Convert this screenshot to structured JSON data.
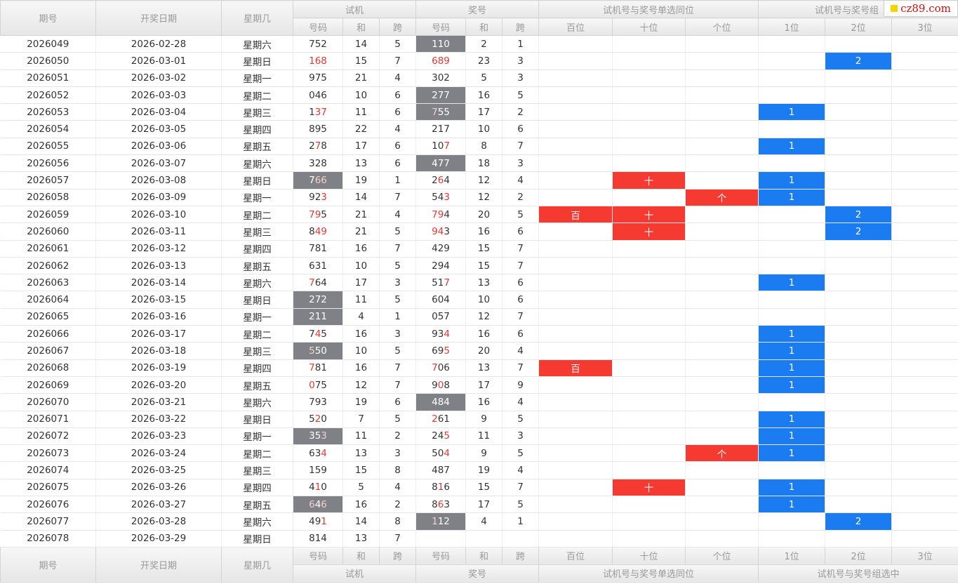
{
  "logo_text": "cz89.com",
  "headers": {
    "period": "期号",
    "date": "开奖日期",
    "weekday": "星期几",
    "trial": "试机",
    "prize": "奖号",
    "single": "试机号与奖号单选同位",
    "group_top": "试机号与奖号组",
    "group_full": "试机号与奖号组选中",
    "sub": {
      "code": "号码",
      "sum": "和",
      "span": "跨",
      "hundreds": "百位",
      "tens": "十位",
      "ones": "个位",
      "pos1": "1位",
      "pos2": "2位",
      "pos3": "3位"
    }
  },
  "rows": [
    {
      "period": "2026049",
      "date": "2026-02-28",
      "weekday": "星期六",
      "trial": [
        [
          "752",
          ""
        ]
      ],
      "trial_sum": "14",
      "trial_span": "5",
      "prize": [
        [
          "110",
          ""
        ]
      ],
      "prize_gray": true,
      "prize_sum": "2",
      "prize_span": "1",
      "single": [
        "",
        "",
        ""
      ],
      "group": [
        "",
        "",
        ""
      ]
    },
    {
      "period": "2026050",
      "date": "2026-03-01",
      "weekday": "星期日",
      "trial": [
        [
          "",
          "168"
        ]
      ],
      "trial_sum": "15",
      "trial_span": "7",
      "prize": [
        [
          "",
          "689"
        ]
      ],
      "prize_sum": "23",
      "prize_span": "3",
      "single": [
        "",
        "",
        ""
      ],
      "group": [
        "",
        "2",
        ""
      ]
    },
    {
      "period": "2026051",
      "date": "2026-03-02",
      "weekday": "星期一",
      "trial": [
        [
          "975",
          ""
        ]
      ],
      "trial_sum": "21",
      "trial_span": "4",
      "prize": [
        [
          "302",
          ""
        ]
      ],
      "prize_sum": "5",
      "prize_span": "3",
      "single": [
        "",
        "",
        ""
      ],
      "group": [
        "",
        "",
        ""
      ]
    },
    {
      "period": "2026052",
      "date": "2026-03-03",
      "weekday": "星期二",
      "trial": [
        [
          "046",
          ""
        ]
      ],
      "trial_sum": "10",
      "trial_span": "6",
      "prize": [
        [
          "277",
          ""
        ]
      ],
      "prize_gray": true,
      "prize_sum": "16",
      "prize_span": "5",
      "single": [
        "",
        "",
        ""
      ],
      "group": [
        "",
        "",
        ""
      ]
    },
    {
      "period": "2026053",
      "date": "2026-03-04",
      "weekday": "星期三",
      "trial": [
        [
          "1",
          ""
        ],
        [
          "",
          "37"
        ]
      ],
      "trial_sum": "11",
      "trial_span": "6",
      "prize": [
        [
          "",
          "7"
        ],
        [
          "55",
          ""
        ]
      ],
      "prize_gray": true,
      "prize_sum": "17",
      "prize_span": "2",
      "single": [
        "",
        "",
        ""
      ],
      "group": [
        "1",
        "",
        ""
      ]
    },
    {
      "period": "2026054",
      "date": "2026-03-05",
      "weekday": "星期四",
      "trial": [
        [
          "895",
          ""
        ]
      ],
      "trial_sum": "22",
      "trial_span": "4",
      "prize": [
        [
          "217",
          ""
        ]
      ],
      "prize_sum": "10",
      "prize_span": "6",
      "single": [
        "",
        "",
        ""
      ],
      "group": [
        "",
        "",
        ""
      ]
    },
    {
      "period": "2026055",
      "date": "2026-03-06",
      "weekday": "星期五",
      "trial": [
        [
          "2",
          ""
        ],
        [
          "",
          "7"
        ],
        [
          "8",
          ""
        ]
      ],
      "trial_sum": "17",
      "trial_span": "6",
      "prize": [
        [
          "10",
          ""
        ],
        [
          "",
          "7"
        ]
      ],
      "prize_sum": "8",
      "prize_span": "7",
      "single": [
        "",
        "",
        ""
      ],
      "group": [
        "1",
        "",
        ""
      ]
    },
    {
      "period": "2026056",
      "date": "2026-03-07",
      "weekday": "星期六",
      "trial": [
        [
          "328",
          ""
        ]
      ],
      "trial_sum": "13",
      "trial_span": "6",
      "prize": [
        [
          "477",
          ""
        ]
      ],
      "prize_gray": true,
      "prize_sum": "18",
      "prize_span": "3",
      "single": [
        "",
        "",
        ""
      ],
      "group": [
        "",
        "",
        ""
      ]
    },
    {
      "period": "2026057",
      "date": "2026-03-08",
      "weekday": "星期日",
      "trial": [
        [
          "7",
          ""
        ],
        [
          "",
          "66"
        ]
      ],
      "trial_gray": true,
      "trial_sum": "19",
      "trial_span": "1",
      "prize": [
        [
          "2",
          ""
        ],
        [
          "",
          "6"
        ],
        [
          "4",
          ""
        ]
      ],
      "prize_sum": "12",
      "prize_span": "4",
      "single": [
        "",
        "十",
        ""
      ],
      "group": [
        "1",
        "",
        ""
      ]
    },
    {
      "period": "2026058",
      "date": "2026-03-09",
      "weekday": "星期一",
      "trial": [
        [
          "92",
          ""
        ],
        [
          "",
          "3"
        ]
      ],
      "trial_sum": "14",
      "trial_span": "7",
      "prize": [
        [
          "54",
          ""
        ],
        [
          "",
          "3"
        ]
      ],
      "prize_sum": "12",
      "prize_span": "2",
      "single": [
        "",
        "",
        "个"
      ],
      "group": [
        "1",
        "",
        ""
      ]
    },
    {
      "period": "2026059",
      "date": "2026-03-10",
      "weekday": "星期二",
      "trial": [
        [
          "",
          "79"
        ],
        [
          "5",
          ""
        ]
      ],
      "trial_sum": "21",
      "trial_span": "4",
      "prize": [
        [
          "",
          "79"
        ],
        [
          "4",
          ""
        ]
      ],
      "prize_sum": "20",
      "prize_span": "5",
      "single": [
        "百",
        "十",
        ""
      ],
      "group": [
        "",
        "2",
        ""
      ]
    },
    {
      "period": "2026060",
      "date": "2026-03-11",
      "weekday": "星期三",
      "trial": [
        [
          "8",
          ""
        ],
        [
          "",
          "49"
        ]
      ],
      "trial_sum": "21",
      "trial_span": "5",
      "prize": [
        [
          "",
          "94"
        ],
        [
          "3",
          ""
        ]
      ],
      "prize_sum": "16",
      "prize_span": "6",
      "single": [
        "",
        "十",
        ""
      ],
      "group": [
        "",
        "2",
        ""
      ]
    },
    {
      "period": "2026061",
      "date": "2026-03-12",
      "weekday": "星期四",
      "trial": [
        [
          "781",
          ""
        ]
      ],
      "trial_sum": "16",
      "trial_span": "7",
      "prize": [
        [
          "429",
          ""
        ]
      ],
      "prize_sum": "15",
      "prize_span": "7",
      "single": [
        "",
        "",
        ""
      ],
      "group": [
        "",
        "",
        ""
      ]
    },
    {
      "period": "2026062",
      "date": "2026-03-13",
      "weekday": "星期五",
      "trial": [
        [
          "631",
          ""
        ]
      ],
      "trial_sum": "10",
      "trial_span": "5",
      "prize": [
        [
          "294",
          ""
        ]
      ],
      "prize_sum": "15",
      "prize_span": "7",
      "single": [
        "",
        "",
        ""
      ],
      "group": [
        "",
        "",
        ""
      ]
    },
    {
      "period": "2026063",
      "date": "2026-03-14",
      "weekday": "星期六",
      "trial": [
        [
          "",
          "7"
        ],
        [
          "64",
          ""
        ]
      ],
      "trial_sum": "17",
      "trial_span": "3",
      "prize": [
        [
          "51",
          ""
        ],
        [
          "",
          "7"
        ]
      ],
      "prize_sum": "13",
      "prize_span": "6",
      "single": [
        "",
        "",
        ""
      ],
      "group": [
        "1",
        "",
        ""
      ]
    },
    {
      "period": "2026064",
      "date": "2026-03-15",
      "weekday": "星期日",
      "trial": [
        [
          "272",
          ""
        ]
      ],
      "trial_gray": true,
      "trial_sum": "11",
      "trial_span": "5",
      "prize": [
        [
          "604",
          ""
        ]
      ],
      "prize_sum": "10",
      "prize_span": "6",
      "single": [
        "",
        "",
        ""
      ],
      "group": [
        "",
        "",
        ""
      ]
    },
    {
      "period": "2026065",
      "date": "2026-03-16",
      "weekday": "星期一",
      "trial": [
        [
          "211",
          ""
        ]
      ],
      "trial_gray": true,
      "trial_sum": "4",
      "trial_span": "1",
      "prize": [
        [
          "057",
          ""
        ]
      ],
      "prize_sum": "12",
      "prize_span": "7",
      "single": [
        "",
        "",
        ""
      ],
      "group": [
        "",
        "",
        ""
      ]
    },
    {
      "period": "2026066",
      "date": "2026-03-17",
      "weekday": "星期二",
      "trial": [
        [
          "7",
          ""
        ],
        [
          "",
          "4"
        ],
        [
          "5",
          ""
        ]
      ],
      "trial_sum": "16",
      "trial_span": "3",
      "prize": [
        [
          "93",
          ""
        ],
        [
          "",
          "4"
        ]
      ],
      "prize_sum": "16",
      "prize_span": "6",
      "single": [
        "",
        "",
        ""
      ],
      "group": [
        "1",
        "",
        ""
      ]
    },
    {
      "period": "2026067",
      "date": "2026-03-18",
      "weekday": "星期三",
      "trial": [
        [
          "",
          "5"
        ],
        [
          "50",
          ""
        ]
      ],
      "trial_gray": true,
      "trial_sum": "10",
      "trial_span": "5",
      "prize": [
        [
          "69",
          ""
        ],
        [
          "",
          "5"
        ]
      ],
      "prize_sum": "20",
      "prize_span": "4",
      "single": [
        "",
        "",
        ""
      ],
      "group": [
        "1",
        "",
        ""
      ]
    },
    {
      "period": "2026068",
      "date": "2026-03-19",
      "weekday": "星期四",
      "trial": [
        [
          "",
          "7"
        ],
        [
          "81",
          ""
        ]
      ],
      "trial_sum": "16",
      "trial_span": "7",
      "prize": [
        [
          "",
          "7"
        ],
        [
          "06",
          ""
        ]
      ],
      "prize_sum": "13",
      "prize_span": "7",
      "single": [
        "百",
        "",
        ""
      ],
      "group": [
        "1",
        "",
        ""
      ]
    },
    {
      "period": "2026069",
      "date": "2026-03-20",
      "weekday": "星期五",
      "trial": [
        [
          "",
          "0"
        ],
        [
          "75",
          ""
        ]
      ],
      "trial_sum": "12",
      "trial_span": "7",
      "prize": [
        [
          "9",
          ""
        ],
        [
          "",
          "0"
        ],
        [
          "8",
          ""
        ]
      ],
      "prize_sum": "17",
      "prize_span": "9",
      "single": [
        "",
        "",
        ""
      ],
      "group": [
        "1",
        "",
        ""
      ]
    },
    {
      "period": "2026070",
      "date": "2026-03-21",
      "weekday": "星期六",
      "trial": [
        [
          "793",
          ""
        ]
      ],
      "trial_sum": "19",
      "trial_span": "6",
      "prize": [
        [
          "484",
          ""
        ]
      ],
      "prize_gray": true,
      "prize_sum": "16",
      "prize_span": "4",
      "single": [
        "",
        "",
        ""
      ],
      "group": [
        "",
        "",
        ""
      ]
    },
    {
      "period": "2026071",
      "date": "2026-03-22",
      "weekday": "星期日",
      "trial": [
        [
          "5",
          ""
        ],
        [
          "",
          "2"
        ],
        [
          "0",
          ""
        ]
      ],
      "trial_sum": "7",
      "trial_span": "5",
      "prize": [
        [
          "",
          "2"
        ],
        [
          "61",
          ""
        ]
      ],
      "prize_sum": "9",
      "prize_span": "5",
      "single": [
        "",
        "",
        ""
      ],
      "group": [
        "1",
        "",
        ""
      ]
    },
    {
      "period": "2026072",
      "date": "2026-03-23",
      "weekday": "星期一",
      "trial": [
        [
          "35",
          ""
        ],
        [
          "",
          "3"
        ]
      ],
      "trial_gray": true,
      "trial_sum": "11",
      "trial_span": "2",
      "prize": [
        [
          "24",
          ""
        ],
        [
          "",
          "5"
        ]
      ],
      "prize_sum": "11",
      "prize_span": "3",
      "single": [
        "",
        "",
        ""
      ],
      "group": [
        "1",
        "",
        ""
      ]
    },
    {
      "period": "2026073",
      "date": "2026-03-24",
      "weekday": "星期二",
      "trial": [
        [
          "63",
          ""
        ],
        [
          "",
          "4"
        ]
      ],
      "trial_sum": "13",
      "trial_span": "3",
      "prize": [
        [
          "50",
          ""
        ],
        [
          "",
          "4"
        ]
      ],
      "prize_sum": "9",
      "prize_span": "5",
      "single": [
        "",
        "",
        "个"
      ],
      "group": [
        "1",
        "",
        ""
      ]
    },
    {
      "period": "2026074",
      "date": "2026-03-25",
      "weekday": "星期三",
      "trial": [
        [
          "159",
          ""
        ]
      ],
      "trial_sum": "15",
      "trial_span": "8",
      "prize": [
        [
          "487",
          ""
        ]
      ],
      "prize_sum": "19",
      "prize_span": "4",
      "single": [
        "",
        "",
        ""
      ],
      "group": [
        "",
        "",
        ""
      ]
    },
    {
      "period": "2026075",
      "date": "2026-03-26",
      "weekday": "星期四",
      "trial": [
        [
          "4",
          ""
        ],
        [
          "",
          "1"
        ],
        [
          "0",
          ""
        ]
      ],
      "trial_sum": "5",
      "trial_span": "4",
      "prize": [
        [
          "8",
          ""
        ],
        [
          "",
          "1"
        ],
        [
          "6",
          ""
        ]
      ],
      "prize_sum": "15",
      "prize_span": "7",
      "single": [
        "",
        "十",
        ""
      ],
      "group": [
        "1",
        "",
        ""
      ]
    },
    {
      "period": "2026076",
      "date": "2026-03-27",
      "weekday": "星期五",
      "trial": [
        [
          "",
          "6"
        ],
        [
          "4",
          ""
        ],
        [
          "",
          "6"
        ]
      ],
      "trial_gray": true,
      "trial_sum": "16",
      "trial_span": "2",
      "prize": [
        [
          "8",
          ""
        ],
        [
          "",
          "6"
        ],
        [
          "3",
          ""
        ]
      ],
      "prize_sum": "17",
      "prize_span": "5",
      "single": [
        "",
        "",
        ""
      ],
      "group": [
        "1",
        "",
        ""
      ]
    },
    {
      "period": "2026077",
      "date": "2026-03-28",
      "weekday": "星期六",
      "trial": [
        [
          "49",
          ""
        ],
        [
          "",
          "1"
        ]
      ],
      "trial_sum": "14",
      "trial_span": "8",
      "prize": [
        [
          "",
          "1"
        ],
        [
          "12",
          ""
        ]
      ],
      "prize_gray": true,
      "prize_sum": "4",
      "prize_span": "1",
      "single": [
        "",
        "",
        ""
      ],
      "group": [
        "",
        "2",
        ""
      ]
    },
    {
      "period": "2026078",
      "date": "2026-03-29",
      "weekday": "星期日",
      "trial": [
        [
          "814",
          ""
        ]
      ],
      "trial_sum": "13",
      "trial_span": "7",
      "prize": [
        [
          "",
          ""
        ]
      ],
      "prize_sum": "",
      "prize_span": "",
      "single": [
        "",
        "",
        ""
      ],
      "group": [
        "",
        "",
        ""
      ]
    }
  ],
  "colors": {
    "red": "#f53a32",
    "blue": "#1a7cf0",
    "gray": "#7f8186",
    "red_digit": "#e53935"
  }
}
